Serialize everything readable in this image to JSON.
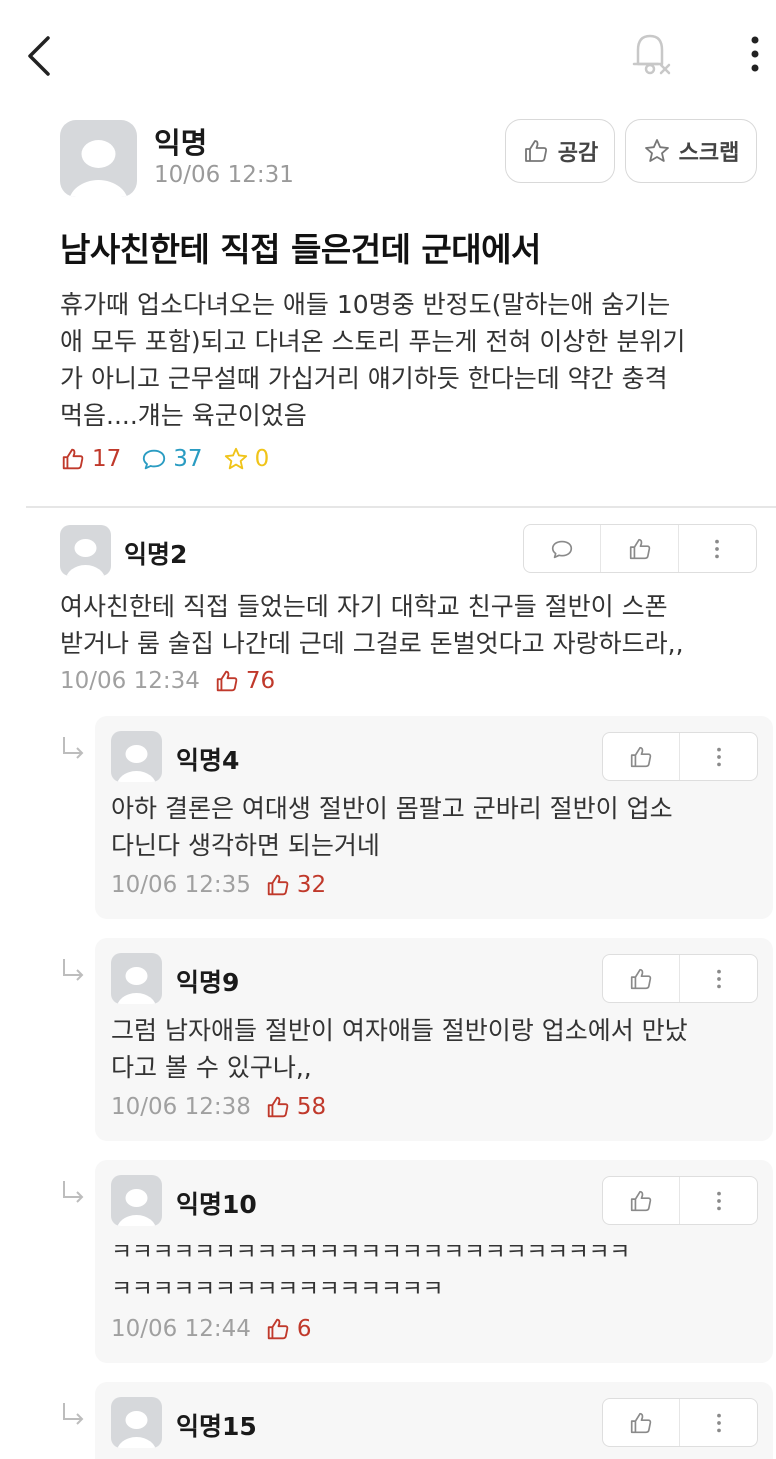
{
  "topbar": {
    "back_icon": "chevron-left-icon",
    "notify_icon": "bell-off-icon",
    "more_icon": "more-vertical-icon"
  },
  "post": {
    "author": "익명",
    "time": "10/06 12:31",
    "like_button_label": "공감",
    "scrap_button_label": "스크랩",
    "title": "남사친한테 직접 들은건데 군대에서",
    "body": "휴가때 업소다녀오는 애들 10명중 반정도(말하는애 숨기는\n애 모두 포함)되고 다녀온 스토리 푸는게 전혀 이상한 분위기\n가 아니고 근무설때 가십거리 얘기하듯 한다는데 약간 충격\n먹음....걔는 육군이었음",
    "stats": {
      "likes": "17",
      "comments": "37",
      "scraps": "0"
    },
    "colors": {
      "like": "#c0392b",
      "comment": "#2a9cc2",
      "scrap": "#f0c419"
    }
  },
  "comments": [
    {
      "author": "익명2",
      "body": "여사친한테 직접 들었는데 자기 대학교 친구들 절반이 스폰\n받거나 룸 술집 나간데 근데 그걸로 돈벌엇다고 자랑하드라,,",
      "time": "10/06 12:34",
      "likes": "76",
      "replies": [
        {
          "author": "익명4",
          "body": "아하 결론은 여대생 절반이 몸팔고 군바리 절반이 업소\n다닌다 생각하면 되는거네",
          "time": "10/06 12:35",
          "likes": "32"
        },
        {
          "author": "익명9",
          "body": "그럼 남자애들 절반이 여자애들 절반이랑 업소에서 만났\n다고 볼 수 있구나,,",
          "time": "10/06 12:38",
          "likes": "58"
        },
        {
          "author": "익명10",
          "body": "ㅋㅋㅋㅋㅋㅋㅋㅋㅋㅋㅋㅋㅋㅋㅋㅋㅋㅋㅋㅋㅋㅋㅋㅋㅋ\nㅋㅋㅋㅋㅋㅋㅋㅋㅋㅋㅋㅋㅋㅋㅋㅋ",
          "time": "10/06 12:44",
          "likes": "6"
        },
        {
          "author": "익명15"
        }
      ]
    }
  ]
}
